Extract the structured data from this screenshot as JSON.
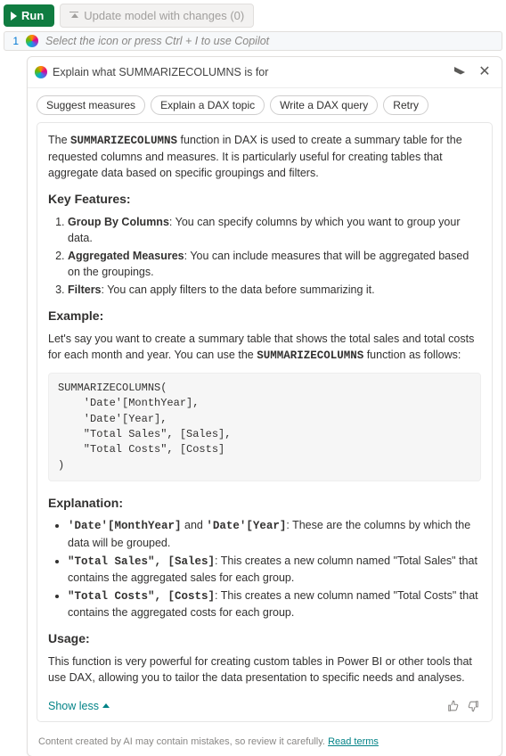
{
  "toolbar": {
    "run_label": "Run",
    "update_label": "Update model with changes (0)"
  },
  "editor": {
    "line_number": "1",
    "placeholder": "Select the icon or press Ctrl + I to use Copilot"
  },
  "copilot": {
    "title": "Explain what SUMMARIZECOLUMNS is for",
    "chips": [
      "Suggest measures",
      "Explain a DAX topic",
      "Write a DAX query",
      "Retry"
    ],
    "intro_pre": "The ",
    "intro_code": "SUMMARIZECOLUMNS",
    "intro_post": " function in DAX is used to create a summary table for the requested columns and measures. It is particularly useful for creating tables that aggregate data based on specific groupings and filters.",
    "h_features": "Key Features:",
    "features": [
      {
        "b": "Group By Columns",
        "t": ": You can specify columns by which you want to group your data."
      },
      {
        "b": "Aggregated Measures",
        "t": ": You can include measures that will be aggregated based on the groupings."
      },
      {
        "b": "Filters",
        "t": ": You can apply filters to the data before summarizing it."
      }
    ],
    "h_example": "Example:",
    "example_pre": "Let's say you want to create a summary table that shows the total sales and total costs for each month and year. You can use the ",
    "example_code": "SUMMARIZECOLUMNS",
    "example_post": " function as follows:",
    "code": "SUMMARIZECOLUMNS(\n    'Date'[MonthYear],\n    'Date'[Year],\n    \"Total Sales\", [Sales],\n    \"Total Costs\", [Costs]\n)",
    "h_explanation": "Explanation:",
    "explanation": [
      {
        "c": "'Date'[MonthYear]",
        "mid": " and ",
        "c2": "'Date'[Year]",
        "t": ": These are the columns by which the data will be grouped."
      },
      {
        "c": "\"Total Sales\", [Sales]",
        "t": ": This creates a new column named \"Total Sales\" that contains the aggregated sales for each group."
      },
      {
        "c": "\"Total Costs\", [Costs]",
        "t": ": This creates a new column named \"Total Costs\" that contains the aggregated costs for each group."
      }
    ],
    "h_usage": "Usage:",
    "usage": "This function is very powerful for creating custom tables in Power BI or other tools that use DAX, allowing you to tailor the data presentation to specific needs and analyses.",
    "show_less": "Show less",
    "disclaimer": "Content created by AI may contain mistakes, so review it carefully. ",
    "read_terms": "Read terms"
  }
}
